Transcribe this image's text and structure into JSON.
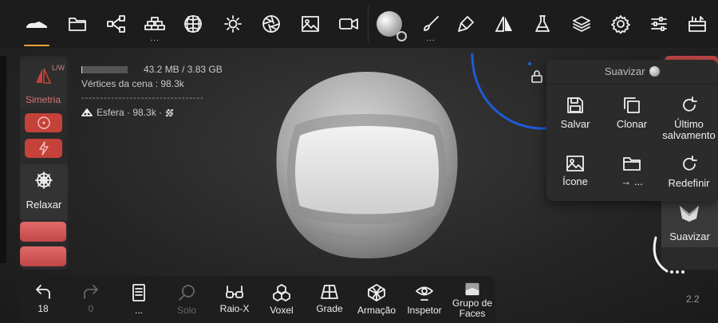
{
  "top_toolbar": {
    "items": [
      {
        "icon": "shoe-icon",
        "active": true
      },
      {
        "icon": "folder-icon"
      },
      {
        "icon": "share-nodes-icon"
      },
      {
        "icon": "bricks-icon",
        "has_more": true
      },
      {
        "icon": "mesh-sphere-icon"
      },
      {
        "icon": "sun-icon"
      },
      {
        "icon": "aperture-icon"
      },
      {
        "icon": "image-icon"
      },
      {
        "icon": "video-icon"
      },
      {
        "icon": "brush-sphere-icon"
      },
      {
        "icon": "brush-icon",
        "has_more": true
      },
      {
        "icon": "paint-tube-icon"
      },
      {
        "icon": "symmetry-icon"
      },
      {
        "icon": "flask-icon"
      },
      {
        "icon": "layers-icon"
      },
      {
        "icon": "gear-icon"
      },
      {
        "icon": "sliders-icon"
      },
      {
        "icon": "toolbox-icon"
      }
    ],
    "more_glyph": "..."
  },
  "scene_info": {
    "memory": "43.2 MB / 3.83 GB",
    "memory_used_fraction": 0.02,
    "vertices": "Vértices da cena : 98.3k",
    "separator": "-----------------------------------------",
    "mesh": "Esfera · 98.3k ·"
  },
  "left_panel": {
    "symmetry_label": "Simetria",
    "symmetry_mode": "L/W",
    "relax_label": "Relaxar"
  },
  "popup": {
    "title": "Suavizar",
    "items": [
      {
        "label": "Salvar",
        "icon": "save-icon"
      },
      {
        "label": "Clonar",
        "icon": "clone-icon"
      },
      {
        "label": "Último salvamento",
        "icon": "reload-icon"
      },
      {
        "label": "Ícone",
        "icon": "image-icon"
      },
      {
        "label": "→ ...",
        "icon": "folder-icon"
      },
      {
        "label": "Redefinir",
        "icon": "reload-icon"
      }
    ]
  },
  "right_panel": {
    "smooth_label": "Suavizar"
  },
  "bottom_toolbar": {
    "undo_count": "18",
    "redo_count": "0",
    "items": [
      {
        "label": "...",
        "icon": "book-icon"
      },
      {
        "label": "Solo",
        "icon": "search-icon",
        "disabled": true
      },
      {
        "label": "Raio-X",
        "icon": "glasses-icon"
      },
      {
        "label": "Voxel",
        "icon": "cubes-icon"
      },
      {
        "label": "Grade",
        "icon": "grid-icon"
      },
      {
        "label": "Armação",
        "icon": "wireframe-icon"
      },
      {
        "label": "Inspetor",
        "icon": "eye-icon"
      },
      {
        "label": "Grupo de Faces",
        "icon": "face-group-icon"
      }
    ]
  },
  "version": "2.2",
  "colors": {
    "accent": "#e6a23c",
    "symmetry_red": "#c4423a",
    "gizmo_blue": "#1e5bd8"
  }
}
